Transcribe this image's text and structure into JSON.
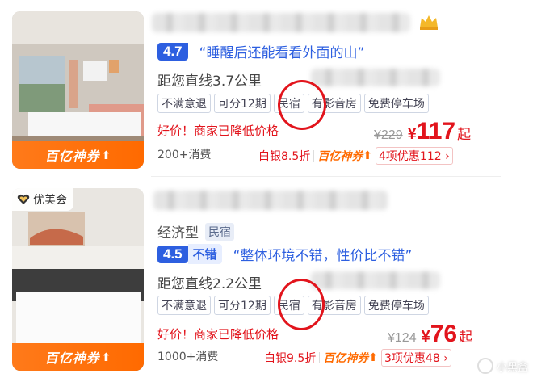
{
  "listings": [
    {
      "score": "4.7",
      "score_word": "",
      "review_quote": "“睡醒后还能看看外面的山”",
      "distance": "距您直线3.7公里",
      "tags": [
        "不满意退",
        "可分12期",
        "民宿",
        "有影音房",
        "免费停车场"
      ],
      "sale_text": "好价！商家已降低价格",
      "consumption": "200+消费",
      "old_price": "¥229",
      "currency": "¥",
      "price": "117",
      "price_suffix": "起",
      "member_discount": "白银8.5折",
      "coupon_label": "百亿神券",
      "discount_count": "4项优惠112",
      "discount_arrow": "›",
      "photo_coupon": "百亿神券"
    },
    {
      "vip_badge": "优美会",
      "hotel_type": "经济型",
      "type_badge": "民宿",
      "score": "4.5",
      "score_word": "不错",
      "review_quote": "“整体环境不错，性价比不错”",
      "distance": "距您直线2.2公里",
      "tags": [
        "不满意退",
        "可分12期",
        "民宿",
        "有影音房",
        "免费停车场"
      ],
      "sale_text": "好价！商家已降低价格",
      "consumption": "1000+消费",
      "old_price": "¥124",
      "currency": "¥",
      "price": "76",
      "price_suffix": "起",
      "member_discount": "白银9.5折",
      "coupon_label": "百亿神券",
      "discount_count": "3项优惠48",
      "discount_arrow": "›",
      "photo_coupon": "百亿神券"
    }
  ],
  "watermark": "小黑盒",
  "icons": {
    "crown": "crown-icon",
    "vip": "heart-badge-icon",
    "coupon_arrow": "up-arrow-icon",
    "watermark": "xiaoheihe-logo-icon"
  },
  "colors": {
    "brand_blue": "#2d5fe0",
    "price_red": "#e2141c",
    "coupon_orange": "#ff6a00",
    "annotation_red": "#e2141c"
  }
}
